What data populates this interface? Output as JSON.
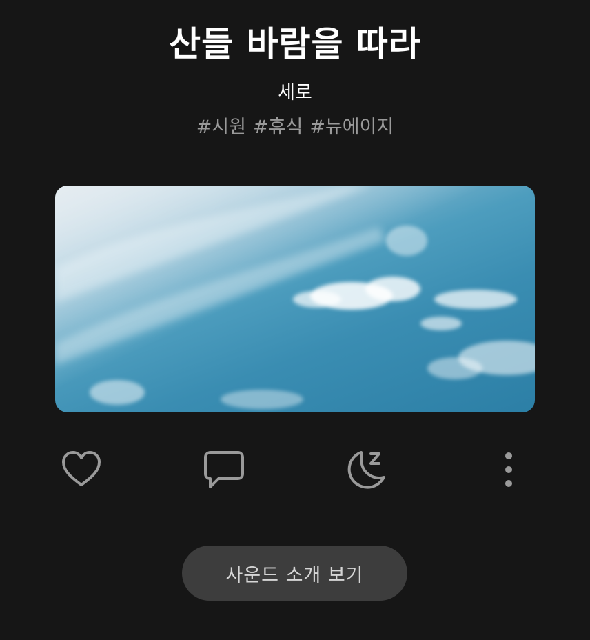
{
  "track": {
    "title": "산들 바람을 따라",
    "artist": "세로",
    "tags": [
      "#시원",
      "#휴식",
      "#뉴에이지"
    ],
    "artwork": "blue-sky-with-clouds"
  },
  "actions": {
    "like_icon": "heart-icon",
    "comment_icon": "speech-bubble-icon",
    "sleep_icon": "moon-z-icon",
    "more_icon": "more-vertical-icon"
  },
  "cta": {
    "label": "사운드 소개 보기"
  },
  "colors": {
    "background": "#161616",
    "icon": "#9a9a9a",
    "tag_text": "#9a9a9a",
    "button_bg": "#3d3d3d"
  }
}
